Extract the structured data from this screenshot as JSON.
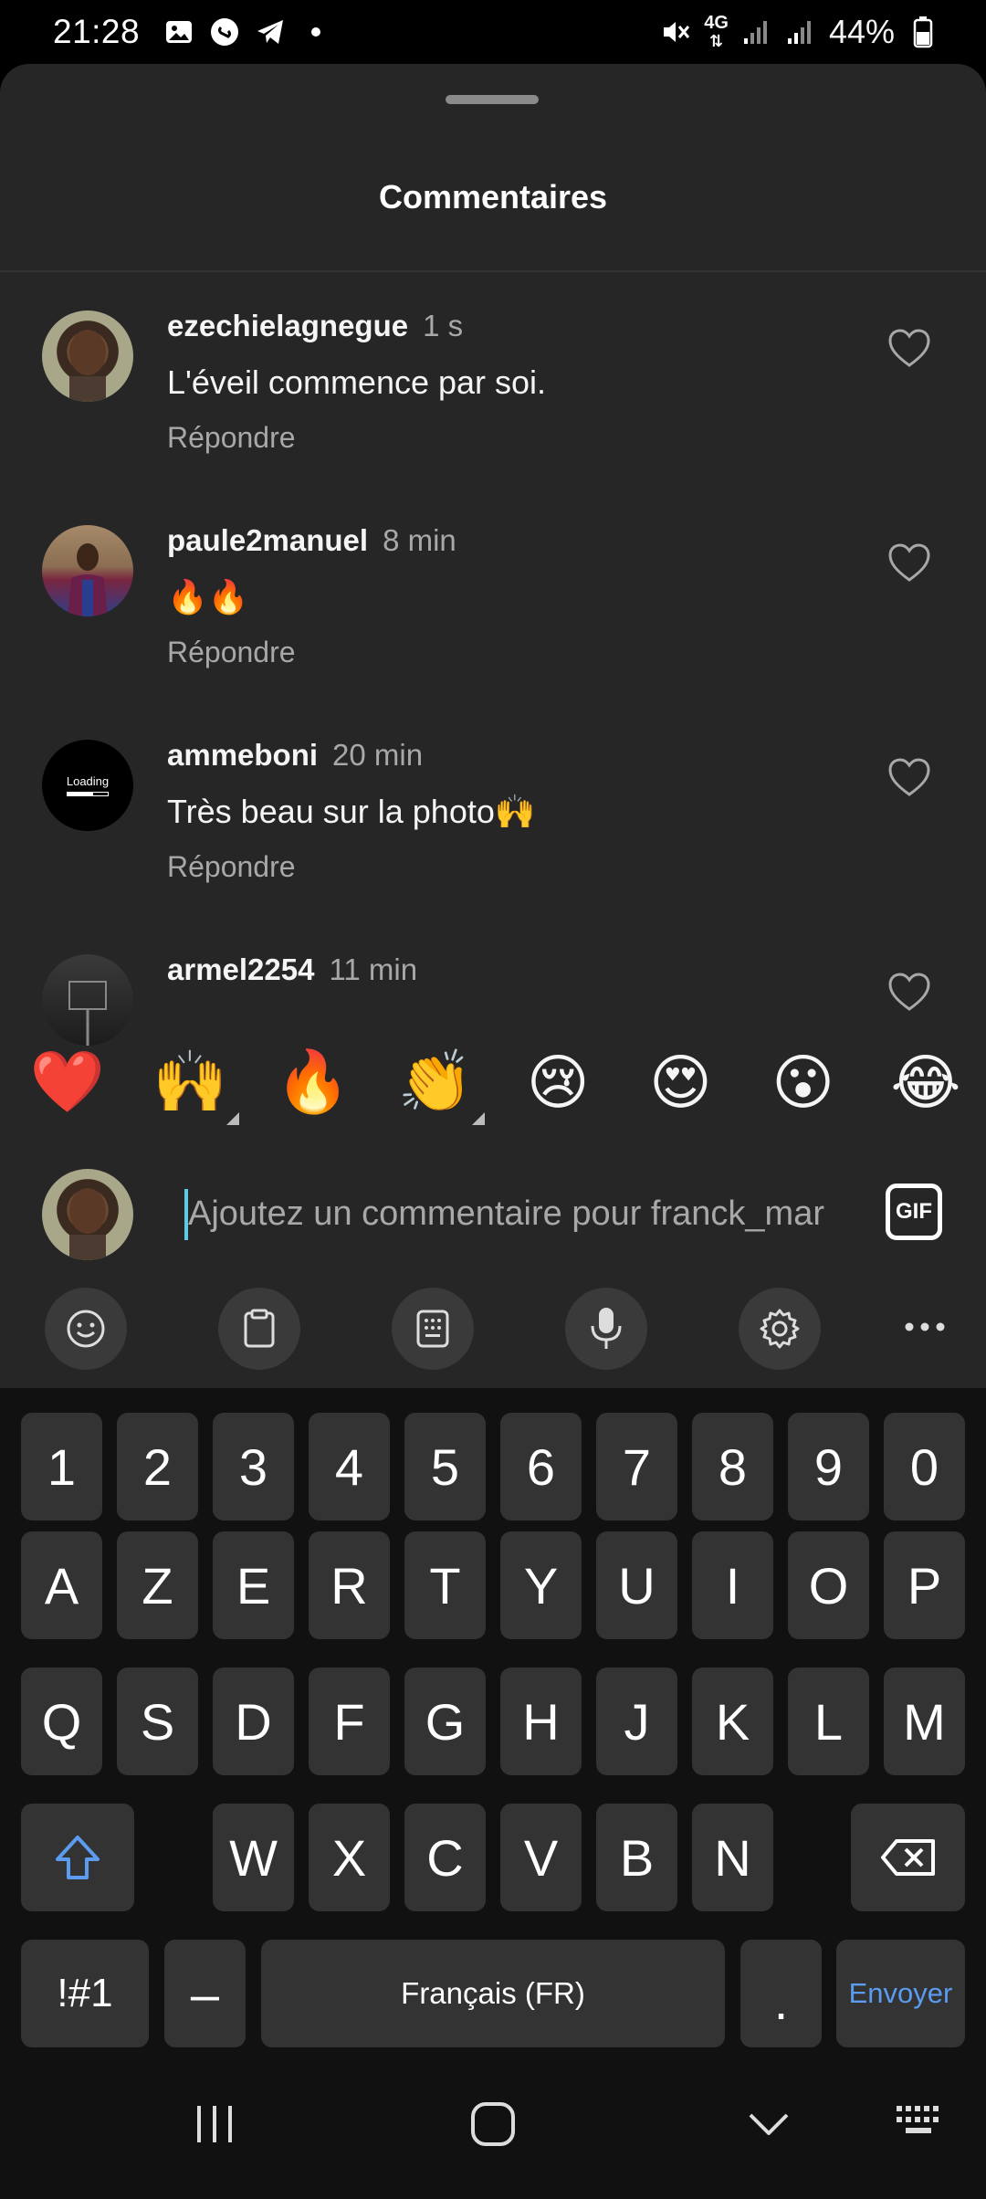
{
  "status_bar": {
    "time": "21:28",
    "battery": "44%",
    "network": "4G"
  },
  "sheet": {
    "title": "Commentaires"
  },
  "comments": [
    {
      "username": "ezechielagnegue",
      "time": "1 s",
      "text": "L'éveil commence par soi.",
      "reply": "Répondre"
    },
    {
      "username": "paule2manuel",
      "time": "8 min",
      "text": "🔥🔥",
      "reply": "Répondre"
    },
    {
      "username": "ammeboni",
      "time": "20 min",
      "text": "Très beau sur la photo🙌",
      "reply": "Répondre",
      "avatar_text": "Loading"
    },
    {
      "username": "armel2254",
      "time": "11 min",
      "text": "",
      "reply": ""
    }
  ],
  "emoji_bar": [
    "❤️",
    "🙌",
    "🔥",
    "👏",
    "😢",
    "😍",
    "😮",
    "😂"
  ],
  "composer": {
    "placeholder": "Ajoutez un commentaire pour franck_mar",
    "gif_label": "GIF"
  },
  "keyboard": {
    "row_numbers": [
      "1",
      "2",
      "3",
      "4",
      "5",
      "6",
      "7",
      "8",
      "9",
      "0"
    ],
    "row_1": [
      "A",
      "Z",
      "E",
      "R",
      "T",
      "Y",
      "U",
      "I",
      "O",
      "P"
    ],
    "row_2": [
      "Q",
      "S",
      "D",
      "F",
      "G",
      "H",
      "J",
      "K",
      "L",
      "M"
    ],
    "row_3": [
      "W",
      "X",
      "C",
      "V",
      "B",
      "N"
    ],
    "symbols_label": "!#1",
    "dash_label": "–",
    "space_label": "Français (FR)",
    "period_label": ".",
    "send_label": "Envoyer"
  },
  "colors": {
    "sheet_bg": "#262626",
    "key_bg": "#333333",
    "accent_blue": "#5b9bf0",
    "like_red": "#ed4956"
  }
}
